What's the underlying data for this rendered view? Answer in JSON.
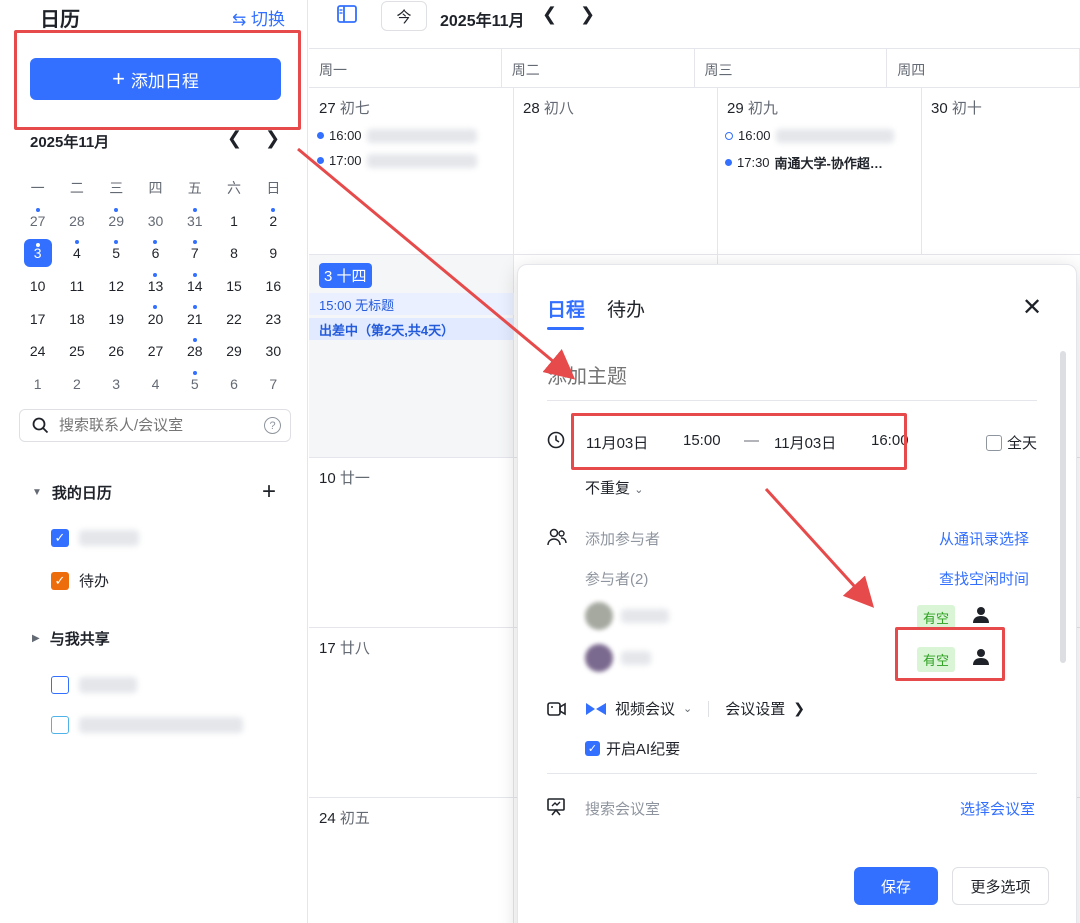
{
  "sidebar": {
    "title": "日历",
    "switch_label": "⇆ 切换",
    "add_label": "添加日程",
    "mini_month": "2025年11月",
    "weekday_heads": [
      "一",
      "二",
      "三",
      "四",
      "五",
      "六",
      "日"
    ],
    "weeks": [
      [
        {
          "d": "27",
          "dot": true,
          "o": true
        },
        {
          "d": "28",
          "o": true
        },
        {
          "d": "29",
          "dot": true,
          "o": true
        },
        {
          "d": "30",
          "o": true
        },
        {
          "d": "31",
          "dot": true,
          "o": true
        },
        {
          "d": "1"
        },
        {
          "d": "2",
          "dot": true
        }
      ],
      [
        {
          "d": "3",
          "dot": true,
          "today": true
        },
        {
          "d": "4",
          "dot": true
        },
        {
          "d": "5",
          "dot": true
        },
        {
          "d": "6",
          "dot": true
        },
        {
          "d": "7",
          "dot": true
        },
        {
          "d": "8"
        },
        {
          "d": "9"
        }
      ],
      [
        {
          "d": "10"
        },
        {
          "d": "11"
        },
        {
          "d": "12"
        },
        {
          "d": "13",
          "dot": true
        },
        {
          "d": "14",
          "dot": true
        },
        {
          "d": "15"
        },
        {
          "d": "16"
        }
      ],
      [
        {
          "d": "17"
        },
        {
          "d": "18"
        },
        {
          "d": "19"
        },
        {
          "d": "20",
          "dot": true
        },
        {
          "d": "21",
          "dot": true
        },
        {
          "d": "22"
        },
        {
          "d": "23"
        }
      ],
      [
        {
          "d": "24"
        },
        {
          "d": "25"
        },
        {
          "d": "26"
        },
        {
          "d": "27"
        },
        {
          "d": "28",
          "dot": true
        },
        {
          "d": "29"
        },
        {
          "d": "30"
        }
      ],
      [
        {
          "d": "1",
          "o": true
        },
        {
          "d": "2",
          "o": true
        },
        {
          "d": "3",
          "o": true
        },
        {
          "d": "4",
          "o": true
        },
        {
          "d": "5",
          "dot": true,
          "o": true
        },
        {
          "d": "6",
          "o": true
        },
        {
          "d": "7",
          "o": true
        }
      ]
    ],
    "search_placeholder": "搜索联系人/会议室",
    "my_calendars_label": "我的日历",
    "todo_label": "待办",
    "shared_label": "与我共享"
  },
  "topbar": {
    "today_label": "今",
    "month_title": "2025年11月"
  },
  "week_headers": [
    "周一",
    "周二",
    "周三",
    "周四"
  ],
  "days": {
    "d27": {
      "num": "27",
      "lunar": "初七"
    },
    "d28": {
      "num": "28",
      "lunar": "初八"
    },
    "d29": {
      "num": "29",
      "lunar": "初九"
    },
    "d30": {
      "num": "30",
      "lunar": "初十"
    },
    "d3": {
      "num": "3",
      "lunar": "十四"
    },
    "d10": {
      "num": "10",
      "lunar": "廿一"
    },
    "d17": {
      "num": "17",
      "lunar": "廿八"
    },
    "d24": {
      "num": "24",
      "lunar": "初五"
    }
  },
  "events": {
    "e27a_time": "16:00",
    "e27b_time": "17:00",
    "e29a_time": "16:00",
    "e29b_time": "17:30",
    "e29b_title": "南通大学-协作超…",
    "e3a": "15:00 无标题",
    "e3b": "出差中（第2天,共4天）"
  },
  "modal": {
    "tab_schedule": "日程",
    "tab_todo": "待办",
    "subject_placeholder": "添加主题",
    "start_date": "11月03日",
    "start_time": "15:00",
    "dash": "—",
    "end_date": "11月03日",
    "end_time": "16:00",
    "all_day": "全天",
    "repeat": "不重复",
    "add_attendee": "添加参与者",
    "from_contacts": "从通讯录选择",
    "attendees_count": "参与者(2)",
    "find_free": "查找空闲时间",
    "free_label": "有空",
    "video_meeting": "视频会议",
    "meeting_settings": "会议设置",
    "ai_minutes": "开启AI纪要",
    "search_room": "搜索会议室",
    "select_room": "选择会议室",
    "save": "保存",
    "more_options": "更多选项"
  },
  "colors": {
    "accent": "#3370ff",
    "annotation": "#e64a4a",
    "free_bg": "#d9f5d6",
    "free_fg": "#2ea121"
  }
}
